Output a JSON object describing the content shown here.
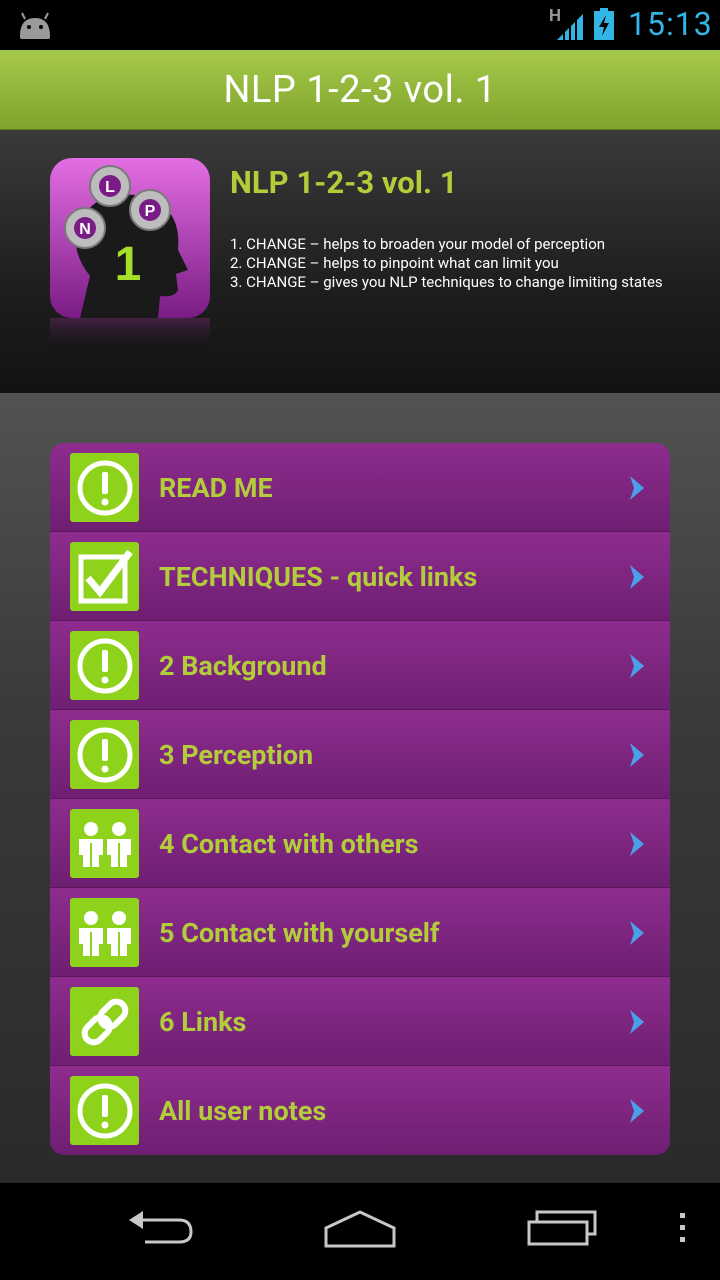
{
  "status_bar": {
    "network": "H",
    "time": "15:13"
  },
  "title_bar": {
    "title": "NLP 1-2-3 vol. 1"
  },
  "header": {
    "logo_letters": [
      "L",
      "N",
      "P",
      "1"
    ],
    "title": "NLP 1-2-3 vol. 1",
    "lines": [
      "1. CHANGE – helps to broaden your model of perception",
      "2. CHANGE – helps to pinpoint what can limit you",
      "3. CHANGE – gives you NLP techniques to change limiting states"
    ]
  },
  "menu": [
    {
      "label": "READ ME",
      "icon": "exclamation-icon"
    },
    {
      "label": "TECHNIQUES - quick links",
      "icon": "checkbox-icon"
    },
    {
      "label": "2 Background",
      "icon": "exclamation-icon"
    },
    {
      "label": "3 Perception",
      "icon": "exclamation-icon"
    },
    {
      "label": "4 Contact with others",
      "icon": "people-icon"
    },
    {
      "label": "5 Contact with yourself",
      "icon": "people-icon"
    },
    {
      "label": "6 Links",
      "icon": "chain-link-icon"
    },
    {
      "label": "All user notes",
      "icon": "exclamation-icon"
    }
  ],
  "colors": {
    "accent_green": "#8ed21c",
    "label_green": "#b3cc3a",
    "item_purple": "#7e2680",
    "title_bar": "#92b83a",
    "clock_blue": "#33b5e5"
  }
}
